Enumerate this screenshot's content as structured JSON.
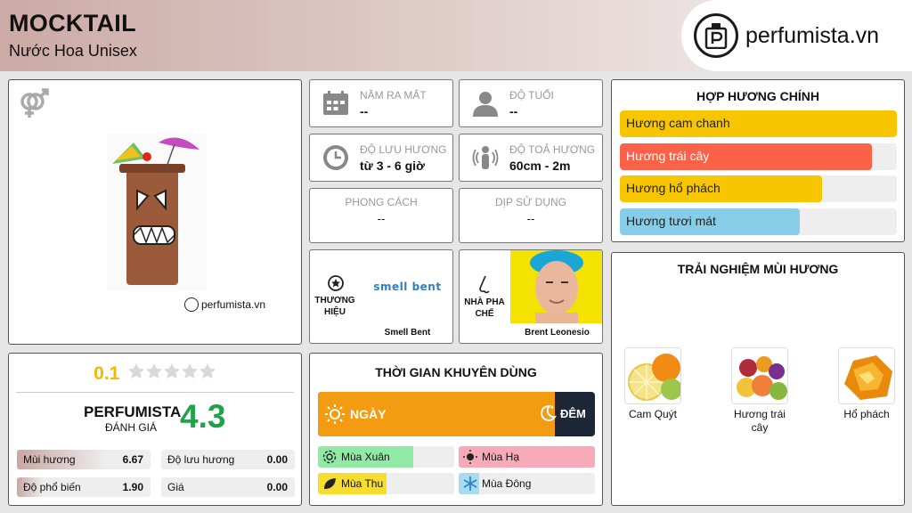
{
  "header": {
    "title": "MOCKTAIL",
    "subtitle": "Nước Hoa Unisex",
    "logo_text": "perfumista.vn"
  },
  "hero": {
    "gender_icon": "unisex-icon",
    "watermark": "perfumista.vn"
  },
  "info": {
    "release": {
      "label": "NĂM RA MẮT",
      "value": "--"
    },
    "age": {
      "label": "ĐỘ TUỔI",
      "value": "--"
    },
    "longevity": {
      "label": "ĐỘ LƯU HƯƠNG",
      "value": "từ 3 - 6 giờ"
    },
    "sillage": {
      "label": "ĐỘ TOẢ HƯƠNG",
      "value": "60cm - 2m"
    },
    "style": {
      "label": "PHONG CÁCH",
      "value": "--"
    },
    "occasion": {
      "label": "DỊP SỬ DỤNG",
      "value": "--"
    },
    "brand": {
      "label": "THƯƠNG HIỆU",
      "name": "Smell Bent",
      "logo_text": "smell bent"
    },
    "perfumer": {
      "label": "NHÀ PHA CHẾ",
      "name": "Brent Leonesio"
    }
  },
  "accords": {
    "title": "HỢP HƯƠNG CHÍNH",
    "items": [
      {
        "name": "Hương cam chanh",
        "level": 1.0,
        "color": "#f7c600"
      },
      {
        "name": "Hương trái cây",
        "level": 0.91,
        "color": "#fb6247"
      },
      {
        "name": "Hương hổ phách",
        "level": 0.73,
        "color": "#f7c600"
      },
      {
        "name": "Hương tươi mát",
        "level": 0.65,
        "color": "#87cde8"
      }
    ]
  },
  "experience": {
    "title": "TRẢI NGHIỆM MÙI HƯƠNG",
    "notes": [
      {
        "name": "Cam Quýt"
      },
      {
        "name": "Hương trái cây"
      },
      {
        "name": "Hổ phách"
      }
    ]
  },
  "rating": {
    "user_score": "0.1",
    "stars_filled": 0,
    "stars_total": 5,
    "brand": "PERFUMISTA",
    "rated_label": "ĐÁNH GIÁ",
    "score": "4.3",
    "stats": [
      {
        "label": "Mùi hương",
        "value": "6.67",
        "level": 0.67
      },
      {
        "label": "Độ lưu hương",
        "value": "0.00",
        "level": 0
      },
      {
        "label": "Độ phổ biến",
        "value": "1.90",
        "level": 0.19
      },
      {
        "label": "Giá",
        "value": "0.00",
        "level": 0
      }
    ]
  },
  "timing": {
    "title": "THỜI GIAN KHUYÊN DÙNG",
    "day_label": "NGÀY",
    "night_label": "ĐÊM",
    "day_share": 0.8,
    "seasons": [
      {
        "name": "Mùa Xuân",
        "level": 0.7,
        "color": "#90eaa6"
      },
      {
        "name": "Mùa Hạ",
        "level": 1.0,
        "color": "#f9aab8"
      },
      {
        "name": "Mùa Thu",
        "level": 0.5,
        "color": "#f7dd2e"
      },
      {
        "name": "Mùa Đông",
        "level": 0.15,
        "color": "#a7dcf0"
      }
    ]
  },
  "colors": {
    "accent_orange": "#f39c12",
    "night": "#1e2738",
    "score_green": "#21a24a",
    "user_score": "#f5b700"
  }
}
